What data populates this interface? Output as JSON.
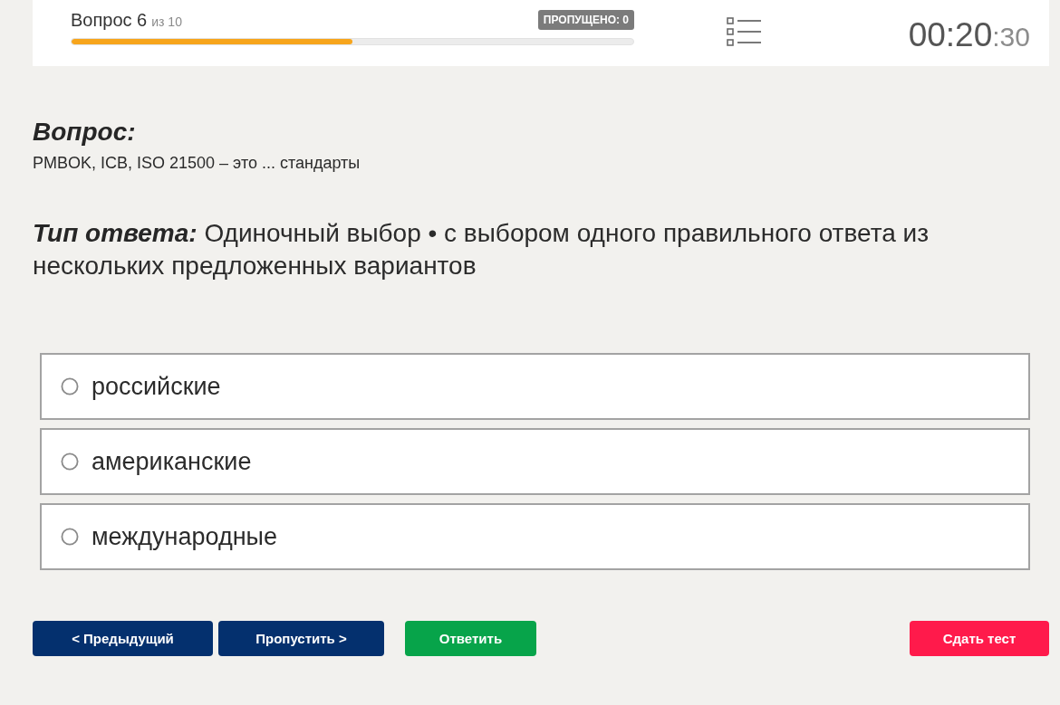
{
  "header": {
    "title": "Вопрос 6",
    "count": "из 10",
    "progress": {
      "level": 0.5
    },
    "skipped_badge": "ПРОПУЩЕНО: 0",
    "timer": {
      "main": "00:20",
      "small": ":30"
    }
  },
  "question": {
    "heading": "Вопрос:",
    "text": "PMBOK, ICB, ISO 21500 – это ... стандарты"
  },
  "answer_type": {
    "text": "**Тип ответа:** Одиночный выбор • с выбором одного правильного ответа из нескольких предложенных вариантов"
  },
  "options": [
    {
      "label": "российские",
      "selected": false
    },
    {
      "label": "американские",
      "selected": false
    },
    {
      "label": "международные",
      "selected": false
    }
  ],
  "buttons": [
    {
      "label": "< Предыдущий",
      "kind": "nav"
    },
    {
      "label": "Пропустить >",
      "kind": "nav"
    },
    {
      "label": "Ответить",
      "kind": "answer"
    },
    {
      "label": "Сдать тест",
      "kind": "submit"
    }
  ]
}
